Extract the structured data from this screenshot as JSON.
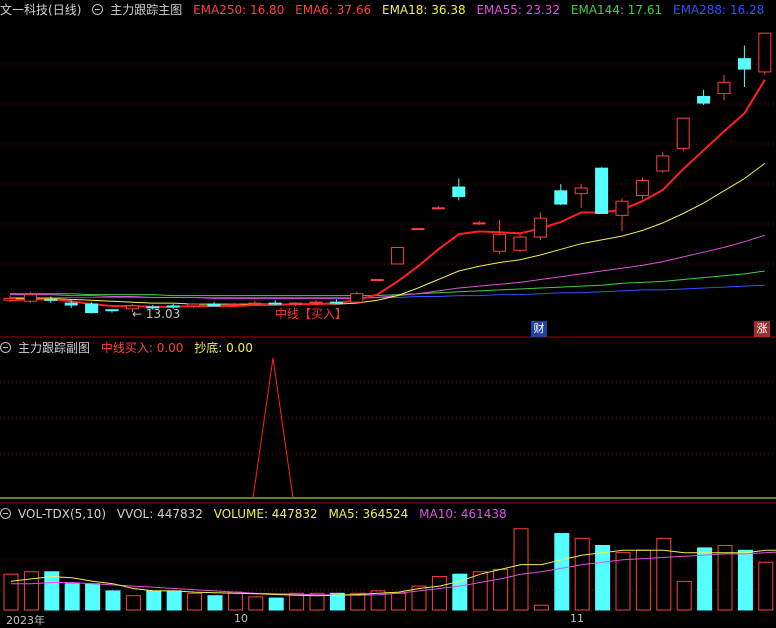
{
  "colors": {
    "up": "#ff4040",
    "down": "#54ffff",
    "grid": "#8b0000",
    "ema6": "#ff2020",
    "ema18": "#f0f050",
    "ema55": "#e050e0",
    "ema144": "#40d040",
    "ema288": "#3050ff"
  },
  "main": {
    "title": "文一科技",
    "period": "(日线)",
    "indicator": "主力跟踪主图",
    "ema250": "EMA250: 16.80",
    "ema6": "EMA6: 37.66",
    "ema18": "EMA18: 36.38",
    "ema55": "EMA55: 23.32",
    "ema144": "EMA144: 17.61",
    "ema288": "EMA288: 16.28",
    "low_label": "← 13.03",
    "buy_label": "中线【买入】",
    "badge_cai": "财",
    "badge_zhang": "涨"
  },
  "sub": {
    "indicator": "主力跟踪副图",
    "buy_line": "中线买入: 0.00",
    "bottom": "抄底: 0.00"
  },
  "vol": {
    "indicator": "VOL-TDX(5,10)",
    "vvol": "VVOL: 447832",
    "volume": "VOLUME: 447832",
    "ma5": "MA5: 364524",
    "ma10": "MA10: 461438"
  },
  "axis": {
    "date1": "2023年",
    "date2": "10",
    "date3": "11"
  },
  "chart_data": {
    "type": "candlestick",
    "candles": [
      {
        "o": 14.3,
        "h": 14.8,
        "l": 14.1,
        "c": 14.5
      },
      {
        "o": 14.2,
        "h": 15.2,
        "l": 14.0,
        "c": 14.9
      },
      {
        "o": 14.4,
        "h": 14.7,
        "l": 14.0,
        "c": 14.3
      },
      {
        "o": 14.0,
        "h": 14.3,
        "l": 13.5,
        "c": 13.8
      },
      {
        "o": 13.9,
        "h": 14.1,
        "l": 12.9,
        "c": 13.0
      },
      {
        "o": 13.3,
        "h": 13.4,
        "l": 13.0,
        "c": 13.2
      },
      {
        "o": 13.4,
        "h": 13.9,
        "l": 13.03,
        "c": 13.7
      },
      {
        "o": 13.6,
        "h": 13.8,
        "l": 13.3,
        "c": 13.5
      },
      {
        "o": 13.7,
        "h": 13.9,
        "l": 13.4,
        "c": 13.6
      },
      {
        "o": 13.7,
        "h": 14.0,
        "l": 13.5,
        "c": 13.9
      },
      {
        "o": 13.9,
        "h": 14.1,
        "l": 13.6,
        "c": 13.7
      },
      {
        "o": 13.8,
        "h": 14.0,
        "l": 13.6,
        "c": 13.9
      },
      {
        "o": 13.9,
        "h": 14.2,
        "l": 13.7,
        "c": 14.0
      },
      {
        "o": 14.0,
        "h": 14.3,
        "l": 13.8,
        "c": 13.9
      },
      {
        "o": 13.9,
        "h": 14.1,
        "l": 13.7,
        "c": 14.0
      },
      {
        "o": 14.0,
        "h": 14.3,
        "l": 13.8,
        "c": 14.1
      },
      {
        "o": 14.1,
        "h": 14.4,
        "l": 13.9,
        "c": 14.0
      },
      {
        "o": 14.1,
        "h": 15.2,
        "l": 14.0,
        "c": 15.0
      },
      {
        "o": 16.5,
        "h": 16.5,
        "l": 16.5,
        "c": 16.5
      },
      {
        "o": 18.15,
        "h": 19.6,
        "l": 18.1,
        "c": 19.9
      },
      {
        "o": 21.9,
        "h": 21.9,
        "l": 21.9,
        "c": 21.9
      },
      {
        "o": 24.1,
        "h": 24.3,
        "l": 23.9,
        "c": 24.1
      },
      {
        "o": 26.3,
        "h": 27.2,
        "l": 24.9,
        "c": 25.3
      },
      {
        "o": 22.5,
        "h": 22.7,
        "l": 22.3,
        "c": 22.5
      },
      {
        "o": 19.5,
        "h": 22.8,
        "l": 19.2,
        "c": 21.3
      },
      {
        "o": 19.6,
        "h": 21.4,
        "l": 19.4,
        "c": 21.0
      },
      {
        "o": 21.0,
        "h": 23.6,
        "l": 20.7,
        "c": 23.0
      },
      {
        "o": 25.9,
        "h": 26.6,
        "l": 24.4,
        "c": 24.5
      },
      {
        "o": 25.6,
        "h": 26.6,
        "l": 24.1,
        "c": 26.2
      },
      {
        "o": 28.3,
        "h": 28.4,
        "l": 23.5,
        "c": 23.5
      },
      {
        "o": 23.3,
        "h": 25.1,
        "l": 21.6,
        "c": 24.8
      },
      {
        "o": 25.4,
        "h": 27.3,
        "l": 25.0,
        "c": 27.0
      },
      {
        "o": 28.0,
        "h": 30.0,
        "l": 27.8,
        "c": 29.6
      },
      {
        "o": 30.4,
        "h": 33.6,
        "l": 30.1,
        "c": 33.6
      },
      {
        "o": 35.9,
        "h": 36.6,
        "l": 35.0,
        "c": 35.2
      },
      {
        "o": 36.2,
        "h": 38.2,
        "l": 35.5,
        "c": 37.4
      },
      {
        "o": 39.9,
        "h": 41.3,
        "l": 36.9,
        "c": 38.8
      },
      {
        "o": 38.5,
        "h": 42.6,
        "l": 38.2,
        "c": 42.6
      }
    ],
    "ema6": [
      14.3,
      14.4,
      14.4,
      14.2,
      13.9,
      13.7,
      13.7,
      13.6,
      13.6,
      13.7,
      13.7,
      13.7,
      13.8,
      13.8,
      13.9,
      13.9,
      14.0,
      14.3,
      14.9,
      16.3,
      17.9,
      19.7,
      21.3,
      21.6,
      21.5,
      21.4,
      21.9,
      22.6,
      23.6,
      23.6,
      23.9,
      24.8,
      26.0,
      28.2,
      30.2,
      32.2,
      34.1,
      37.66
    ],
    "ema18": [
      14.5,
      14.5,
      14.5,
      14.4,
      14.3,
      14.2,
      14.1,
      14.0,
      14.0,
      13.9,
      13.9,
      13.9,
      13.9,
      13.9,
      13.9,
      13.9,
      13.9,
      14.0,
      14.3,
      14.8,
      15.6,
      16.5,
      17.4,
      17.9,
      18.3,
      18.6,
      19.1,
      19.7,
      20.3,
      20.7,
      21.1,
      21.7,
      22.5,
      23.5,
      24.6,
      25.9,
      27.2,
      28.8
    ],
    "ema55": [
      14.9,
      14.9,
      14.9,
      14.8,
      14.8,
      14.7,
      14.7,
      14.6,
      14.6,
      14.6,
      14.5,
      14.5,
      14.5,
      14.5,
      14.5,
      14.5,
      14.5,
      14.5,
      14.6,
      14.8,
      15.0,
      15.3,
      15.6,
      15.8,
      16.0,
      16.2,
      16.5,
      16.8,
      17.1,
      17.4,
      17.7,
      18.0,
      18.4,
      18.9,
      19.4,
      19.9,
      20.5,
      21.2
    ],
    "ema144": [
      15.0,
      15.0,
      15.0,
      15.0,
      14.9,
      14.9,
      14.9,
      14.9,
      14.8,
      14.8,
      14.8,
      14.8,
      14.8,
      14.8,
      14.8,
      14.8,
      14.8,
      14.8,
      14.8,
      14.9,
      15.0,
      15.1,
      15.2,
      15.3,
      15.4,
      15.5,
      15.6,
      15.7,
      15.8,
      15.9,
      16.1,
      16.2,
      16.3,
      16.5,
      16.7,
      16.9,
      17.1,
      17.4
    ],
    "ema288": [
      14.6,
      14.6,
      14.6,
      14.6,
      14.6,
      14.6,
      14.6,
      14.6,
      14.6,
      14.6,
      14.6,
      14.6,
      14.6,
      14.6,
      14.6,
      14.6,
      14.6,
      14.6,
      14.6,
      14.6,
      14.7,
      14.7,
      14.8,
      14.8,
      14.9,
      14.9,
      15.0,
      15.1,
      15.1,
      15.2,
      15.3,
      15.4,
      15.4,
      15.5,
      15.6,
      15.7,
      15.8,
      15.9
    ],
    "volume": [
      150,
      160,
      160,
      110,
      110,
      80,
      60,
      80,
      80,
      70,
      60,
      75,
      55,
      50,
      70,
      70,
      70,
      70,
      80,
      70,
      100,
      140,
      150,
      160,
      170,
      340,
      20,
      320,
      300,
      270,
      240,
      250,
      300,
      120,
      260,
      270,
      250,
      200,
      260,
      300
    ],
    "vma5": [
      120,
      130,
      140,
      135,
      120,
      110,
      90,
      80,
      80,
      75,
      72,
      70,
      68,
      65,
      62,
      60,
      62,
      65,
      70,
      75,
      90,
      100,
      120,
      150,
      170,
      190,
      190,
      210,
      230,
      240,
      250,
      250,
      250,
      240,
      240,
      240,
      240,
      250,
      250,
      260
    ],
    "vma10": [
      110,
      110,
      115,
      115,
      110,
      105,
      100,
      95,
      90,
      85,
      80,
      75,
      70,
      68,
      66,
      64,
      63,
      62,
      64,
      70,
      80,
      90,
      100,
      115,
      130,
      150,
      160,
      175,
      190,
      200,
      210,
      215,
      220,
      225,
      230,
      235,
      235,
      240,
      245,
      250
    ]
  }
}
